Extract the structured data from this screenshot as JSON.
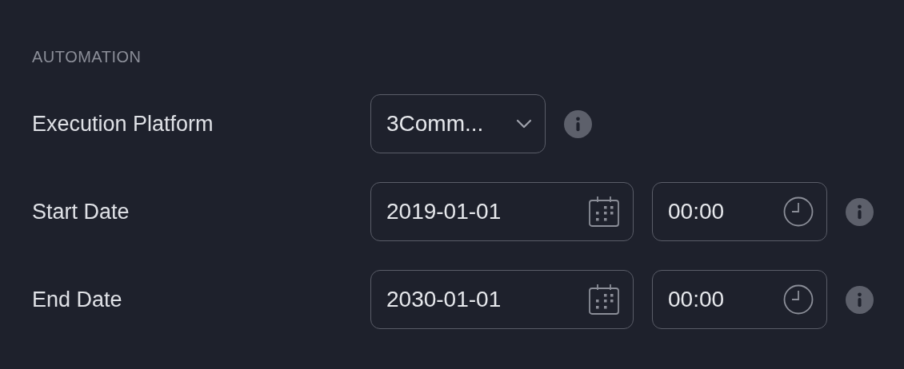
{
  "section_title": "AUTOMATION",
  "rows": [
    {
      "kind": "select",
      "label": "Execution Platform",
      "value": "3Comm..."
    },
    {
      "kind": "datetime",
      "label": "Start Date",
      "date": "2019-01-01",
      "time": "00:00"
    },
    {
      "kind": "datetime",
      "label": "End Date",
      "date": "2030-01-01",
      "time": "00:00"
    }
  ]
}
